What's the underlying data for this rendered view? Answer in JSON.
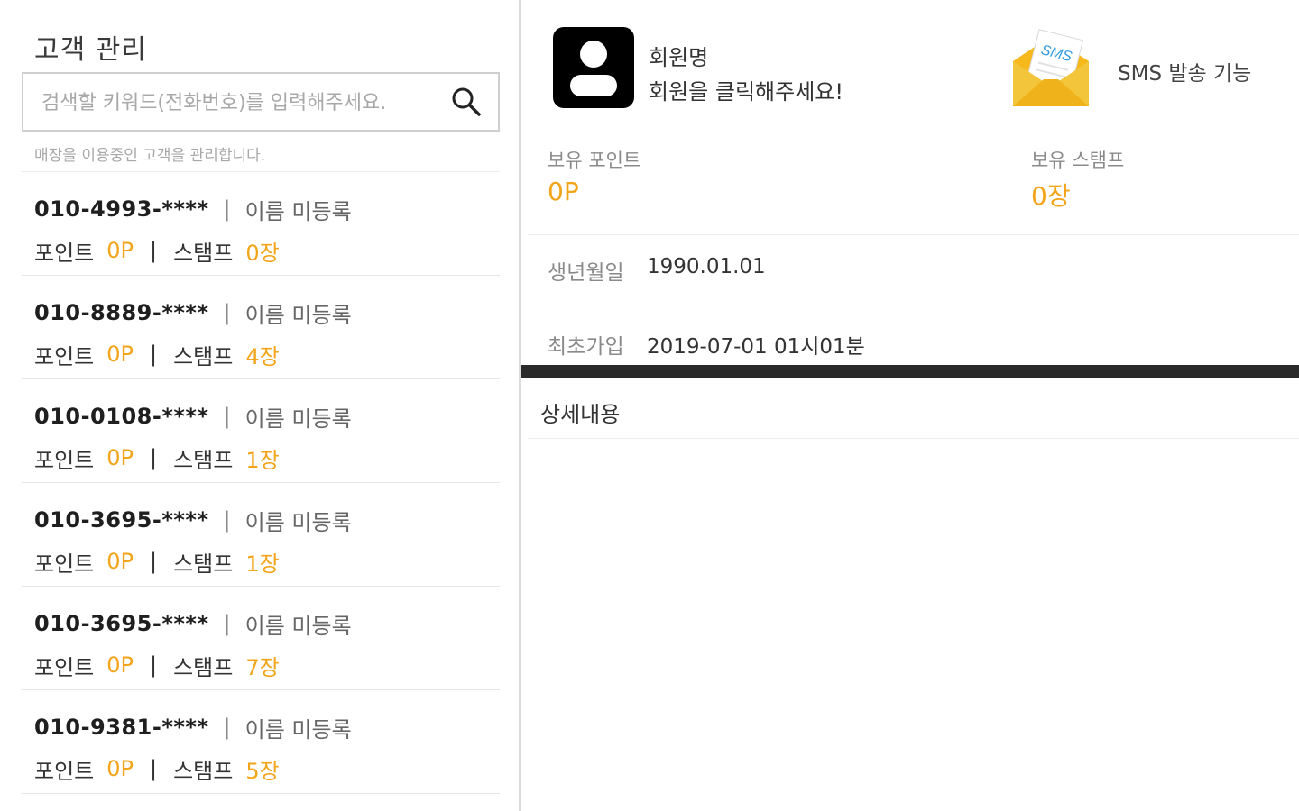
{
  "left_panel": {
    "title": "고객 관리",
    "search": {
      "placeholder": "검색할 키워드(전화번호)를 입력해주세요.",
      "value": "",
      "icon": "search-icon"
    },
    "hint": "매장을 이용중인 고객을 관리합니다.",
    "customers": [
      {
        "phone": "010-4993-****",
        "separator": "|",
        "name": "이름 미등록",
        "points_label": "포인트",
        "points": "0P",
        "stamps_label": "스탬프",
        "stamps": "0장"
      },
      {
        "phone": "010-8889-****",
        "separator": "|",
        "name": "이름 미등록",
        "points_label": "포인트",
        "points": "0P",
        "stamps_label": "스탬프",
        "stamps": "4장"
      },
      {
        "phone": "010-0108-****",
        "separator": "|",
        "name": "이름 미등록",
        "points_label": "포인트",
        "points": "0P",
        "stamps_label": "스탬프",
        "stamps": "1장"
      },
      {
        "phone": "010-3695-****",
        "separator": "|",
        "name": "이름 미등록",
        "points_label": "포인트",
        "points": "0P",
        "stamps_label": "스탬프",
        "stamps": "1장"
      },
      {
        "phone": "010-3695-****",
        "separator": "|",
        "name": "이름 미등록",
        "points_label": "포인트",
        "points": "0P",
        "stamps_label": "스탬프",
        "stamps": "7장"
      },
      {
        "phone": "010-9381-****",
        "separator": "|",
        "name": "이름 미등록",
        "points_label": "포인트",
        "points": "0P",
        "stamps_label": "스탬프",
        "stamps": "5장"
      }
    ]
  },
  "member": {
    "avatar_icon": "user-avatar-icon",
    "name_label": "회원명",
    "prompt": "회원을 클릭해주세요!"
  },
  "sms": {
    "icon": "sms-envelope-icon",
    "badge_text": "SMS",
    "label": "SMS 발송 기능"
  },
  "stats": {
    "points_title": "보유 포인트",
    "points_value": "0P",
    "stamps_title": "보유 스탬프",
    "stamps_value": "0장"
  },
  "info": {
    "birth_label": "생년월일",
    "birth_value": "1990.01.01",
    "join_label": "최초가입",
    "join_value": "2019-07-01 01시01분"
  },
  "detail": {
    "title": "상세내용"
  },
  "colors": {
    "accent": "#f2a51a",
    "text_dark": "#1f1f1f",
    "text_muted": "#8a8a8a",
    "divider": "#e6e6e6",
    "bar": "#2a2a2a"
  }
}
